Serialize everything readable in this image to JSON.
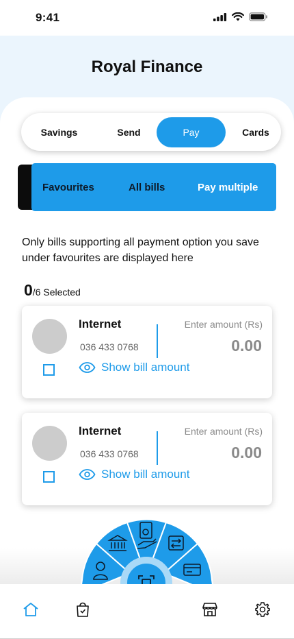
{
  "status_bar": {
    "time": "9:41"
  },
  "app": {
    "title": "Royal Finance"
  },
  "tabs": [
    {
      "label": "Savings",
      "active": false
    },
    {
      "label": "Send",
      "active": false
    },
    {
      "label": "Pay",
      "active": true
    },
    {
      "label": "Cards",
      "active": false
    }
  ],
  "subtabs": [
    {
      "label": "Favourites"
    },
    {
      "label": "All bills"
    },
    {
      "label": "Pay multiple"
    }
  ],
  "info_text": "Only bills supporting all payment option you save under favourites are displayed here",
  "selection": {
    "count": "0",
    "label": "/6 Selected"
  },
  "bills": [
    {
      "name": "Internet",
      "number": "036 433 0768",
      "amount_label": "Enter amount (Rs)",
      "amount": "0.00",
      "show_label": "Show bill amount",
      "checked": false
    },
    {
      "name": "Internet",
      "number": "036 433 0768",
      "amount_label": "Enter amount (Rs)",
      "amount": "0.00",
      "show_label": "Show bill amount",
      "checked": false
    }
  ],
  "radial_menu": {
    "items": [
      "user-icon",
      "bank-icon",
      "bill-payment-icon",
      "transfer-icon",
      "card-icon"
    ],
    "center": "scan-icon"
  },
  "bottom_nav": [
    "home-icon",
    "shopping-bag-icon",
    "store-icon",
    "settings-icon"
  ],
  "colors": {
    "accent": "#1e9be9",
    "header_bg": "#ebf5fd",
    "muted": "#8a8a8a"
  }
}
